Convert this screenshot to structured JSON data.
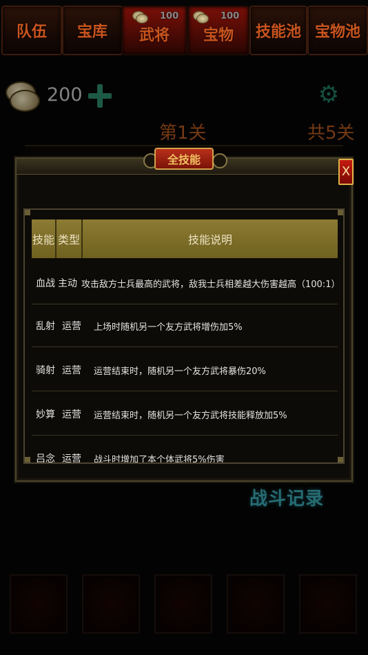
{
  "tabs": [
    {
      "label": "队伍"
    },
    {
      "label": "宝库"
    },
    {
      "label": "武将",
      "badge": "100"
    },
    {
      "label": "宝物",
      "badge": "100"
    },
    {
      "label": "技能池"
    },
    {
      "label": "宝物池"
    }
  ],
  "currency": {
    "amount": "200"
  },
  "stage": {
    "current": "第1关",
    "total": "共5关"
  },
  "battle_log_label": "战斗记录",
  "modal": {
    "title": "全技能",
    "close_label": "X",
    "headers": {
      "skill": "技能",
      "type": "类型",
      "desc": "技能说明"
    },
    "rows": [
      {
        "skill": "血战",
        "type": "主动",
        "desc": "攻击敌方士兵最高的武将，敌我士兵相差越大伤害越高（100:1）"
      },
      {
        "skill": "乱射",
        "type": "运营",
        "desc": "上场时随机另一个友方武将增伤加5%"
      },
      {
        "skill": "骑射",
        "type": "运营",
        "desc": "运营结束时，随机另一个友方武将暴伤20%"
      },
      {
        "skill": "妙算",
        "type": "运营",
        "desc": "运营结束时，随机另一个友方武将技能释放加5%"
      },
      {
        "skill": "吕念",
        "type": "运营",
        "desc": "战斗时增加了本个体武将5%伤害"
      }
    ]
  },
  "colors": {
    "tab_text": "#c9541e",
    "stage_text": "#b3581f",
    "accent_teal": "#2d8a6a",
    "table_header": "#8c7b33"
  }
}
